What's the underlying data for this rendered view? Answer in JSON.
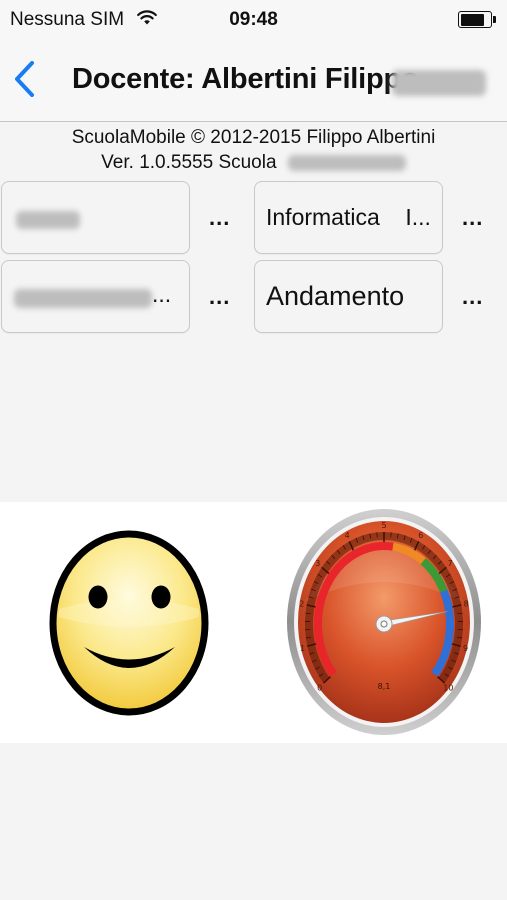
{
  "status_bar": {
    "carrier": "Nessuna SIM",
    "time": "09:48",
    "wifi_icon": "wifi-icon",
    "battery_icon": "battery-icon"
  },
  "nav": {
    "back_icon": "chevron-left-icon",
    "title": "Docente: Albertini Filippo",
    "accent_color": "#1a7cf5"
  },
  "info": {
    "line1": "ScuolaMobile © 2012-2015 Filippo Albertini",
    "line2": "Ver. 1.0.5555 Scuola"
  },
  "selectors": {
    "class_value": "",
    "subject_value": "Informatica    I...",
    "student_value": "",
    "view_value": "Andamento",
    "more_label": "..."
  },
  "gauge": {
    "value_label": "8,1",
    "value": 8.1,
    "min": 0,
    "max": 10,
    "ticks": [
      "0",
      "1",
      "2",
      "3",
      "4",
      "5",
      "6",
      "7",
      "8",
      "9",
      "10"
    ],
    "colors": {
      "red": "#e8252b",
      "orange": "#f08a24",
      "green": "#3a9a35",
      "blue": "#2f6fd6",
      "face": "#d9542a"
    }
  },
  "smiley": {
    "icon": "smiley-icon",
    "color": "#f5d54a"
  }
}
